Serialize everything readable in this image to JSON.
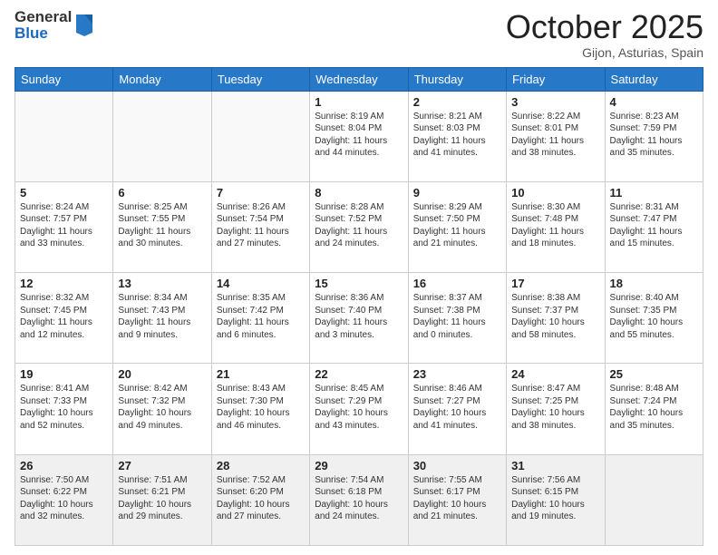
{
  "header": {
    "logo_general": "General",
    "logo_blue": "Blue",
    "month": "October 2025",
    "location": "Gijon, Asturias, Spain"
  },
  "days_of_week": [
    "Sunday",
    "Monday",
    "Tuesday",
    "Wednesday",
    "Thursday",
    "Friday",
    "Saturday"
  ],
  "weeks": [
    [
      {
        "day": "",
        "content": ""
      },
      {
        "day": "",
        "content": ""
      },
      {
        "day": "",
        "content": ""
      },
      {
        "day": "1",
        "content": "Sunrise: 8:19 AM\nSunset: 8:04 PM\nDaylight: 11 hours and 44 minutes."
      },
      {
        "day": "2",
        "content": "Sunrise: 8:21 AM\nSunset: 8:03 PM\nDaylight: 11 hours and 41 minutes."
      },
      {
        "day": "3",
        "content": "Sunrise: 8:22 AM\nSunset: 8:01 PM\nDaylight: 11 hours and 38 minutes."
      },
      {
        "day": "4",
        "content": "Sunrise: 8:23 AM\nSunset: 7:59 PM\nDaylight: 11 hours and 35 minutes."
      }
    ],
    [
      {
        "day": "5",
        "content": "Sunrise: 8:24 AM\nSunset: 7:57 PM\nDaylight: 11 hours and 33 minutes."
      },
      {
        "day": "6",
        "content": "Sunrise: 8:25 AM\nSunset: 7:55 PM\nDaylight: 11 hours and 30 minutes."
      },
      {
        "day": "7",
        "content": "Sunrise: 8:26 AM\nSunset: 7:54 PM\nDaylight: 11 hours and 27 minutes."
      },
      {
        "day": "8",
        "content": "Sunrise: 8:28 AM\nSunset: 7:52 PM\nDaylight: 11 hours and 24 minutes."
      },
      {
        "day": "9",
        "content": "Sunrise: 8:29 AM\nSunset: 7:50 PM\nDaylight: 11 hours and 21 minutes."
      },
      {
        "day": "10",
        "content": "Sunrise: 8:30 AM\nSunset: 7:48 PM\nDaylight: 11 hours and 18 minutes."
      },
      {
        "day": "11",
        "content": "Sunrise: 8:31 AM\nSunset: 7:47 PM\nDaylight: 11 hours and 15 minutes."
      }
    ],
    [
      {
        "day": "12",
        "content": "Sunrise: 8:32 AM\nSunset: 7:45 PM\nDaylight: 11 hours and 12 minutes."
      },
      {
        "day": "13",
        "content": "Sunrise: 8:34 AM\nSunset: 7:43 PM\nDaylight: 11 hours and 9 minutes."
      },
      {
        "day": "14",
        "content": "Sunrise: 8:35 AM\nSunset: 7:42 PM\nDaylight: 11 hours and 6 minutes."
      },
      {
        "day": "15",
        "content": "Sunrise: 8:36 AM\nSunset: 7:40 PM\nDaylight: 11 hours and 3 minutes."
      },
      {
        "day": "16",
        "content": "Sunrise: 8:37 AM\nSunset: 7:38 PM\nDaylight: 11 hours and 0 minutes."
      },
      {
        "day": "17",
        "content": "Sunrise: 8:38 AM\nSunset: 7:37 PM\nDaylight: 10 hours and 58 minutes."
      },
      {
        "day": "18",
        "content": "Sunrise: 8:40 AM\nSunset: 7:35 PM\nDaylight: 10 hours and 55 minutes."
      }
    ],
    [
      {
        "day": "19",
        "content": "Sunrise: 8:41 AM\nSunset: 7:33 PM\nDaylight: 10 hours and 52 minutes."
      },
      {
        "day": "20",
        "content": "Sunrise: 8:42 AM\nSunset: 7:32 PM\nDaylight: 10 hours and 49 minutes."
      },
      {
        "day": "21",
        "content": "Sunrise: 8:43 AM\nSunset: 7:30 PM\nDaylight: 10 hours and 46 minutes."
      },
      {
        "day": "22",
        "content": "Sunrise: 8:45 AM\nSunset: 7:29 PM\nDaylight: 10 hours and 43 minutes."
      },
      {
        "day": "23",
        "content": "Sunrise: 8:46 AM\nSunset: 7:27 PM\nDaylight: 10 hours and 41 minutes."
      },
      {
        "day": "24",
        "content": "Sunrise: 8:47 AM\nSunset: 7:25 PM\nDaylight: 10 hours and 38 minutes."
      },
      {
        "day": "25",
        "content": "Sunrise: 8:48 AM\nSunset: 7:24 PM\nDaylight: 10 hours and 35 minutes."
      }
    ],
    [
      {
        "day": "26",
        "content": "Sunrise: 7:50 AM\nSunset: 6:22 PM\nDaylight: 10 hours and 32 minutes."
      },
      {
        "day": "27",
        "content": "Sunrise: 7:51 AM\nSunset: 6:21 PM\nDaylight: 10 hours and 29 minutes."
      },
      {
        "day": "28",
        "content": "Sunrise: 7:52 AM\nSunset: 6:20 PM\nDaylight: 10 hours and 27 minutes."
      },
      {
        "day": "29",
        "content": "Sunrise: 7:54 AM\nSunset: 6:18 PM\nDaylight: 10 hours and 24 minutes."
      },
      {
        "day": "30",
        "content": "Sunrise: 7:55 AM\nSunset: 6:17 PM\nDaylight: 10 hours and 21 minutes."
      },
      {
        "day": "31",
        "content": "Sunrise: 7:56 AM\nSunset: 6:15 PM\nDaylight: 10 hours and 19 minutes."
      },
      {
        "day": "",
        "content": ""
      }
    ]
  ]
}
